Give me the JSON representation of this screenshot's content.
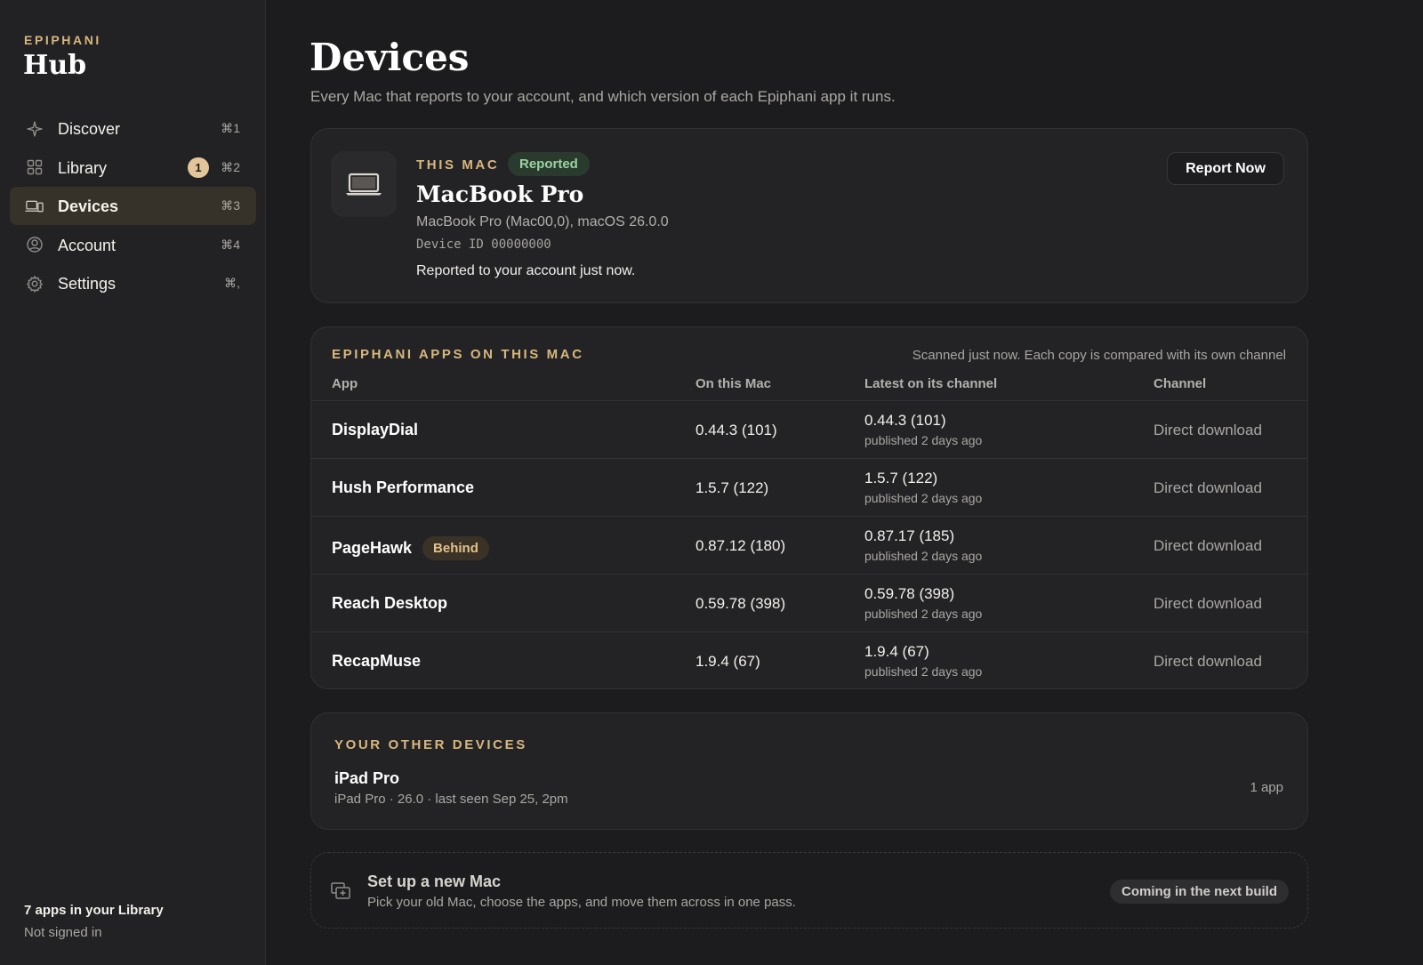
{
  "sidebar": {
    "brand_kicker": "EPIPHANI",
    "brand_title": "Hub",
    "items": [
      {
        "label": "Discover",
        "shortcut": "⌘1",
        "icon": "sparkle-icon",
        "active": false
      },
      {
        "label": "Library",
        "shortcut": "⌘2",
        "icon": "grid-icon",
        "badge": "1",
        "active": false
      },
      {
        "label": "Devices",
        "shortcut": "⌘3",
        "icon": "devices-icon",
        "active": true
      },
      {
        "label": "Account",
        "shortcut": "⌘4",
        "icon": "person-circle-icon",
        "active": false
      },
      {
        "label": "Settings",
        "shortcut": "⌘,",
        "icon": "gear-icon",
        "active": false
      }
    ],
    "footer": {
      "library_count": "7 apps in your Library",
      "auth_status": "Not signed in"
    }
  },
  "main": {
    "title": "Devices",
    "subtitle": "Every Mac that reports to your account, and which version of each Epiphani app it runs."
  },
  "this_mac": {
    "kicker": "THIS MAC",
    "status": "Reported",
    "name": "MacBook Pro",
    "model": "MacBook Pro (Mac00,0), macOS 26.0.0",
    "device_id": "Device ID 00000000",
    "reported_text": "Reported to your account just now.",
    "report_button": "Report Now",
    "icon": "laptop-icon"
  },
  "apps": {
    "kicker": "EPIPHANI APPS ON THIS MAC",
    "note": "Scanned just now. Each copy is compared with its own channel",
    "headers": {
      "app": "App",
      "on_mac": "On this Mac",
      "latest": "Latest on its channel",
      "channel": "Channel"
    },
    "rows": [
      {
        "name": "DisplayDial",
        "badge": "",
        "on_mac": "0.44.3 (101)",
        "latest": "0.44.3 (101)",
        "published": "published 2 days ago",
        "channel": "Direct download"
      },
      {
        "name": "Hush Performance",
        "badge": "",
        "on_mac": "1.5.7 (122)",
        "latest": "1.5.7 (122)",
        "published": "published 2 days ago",
        "channel": "Direct download"
      },
      {
        "name": "PageHawk",
        "badge": "Behind",
        "on_mac": "0.87.12 (180)",
        "latest": "0.87.17 (185)",
        "published": "published 2 days ago",
        "channel": "Direct download"
      },
      {
        "name": "Reach Desktop",
        "badge": "",
        "on_mac": "0.59.78 (398)",
        "latest": "0.59.78 (398)",
        "published": "published 2 days ago",
        "channel": "Direct download"
      },
      {
        "name": "RecapMuse",
        "badge": "",
        "on_mac": "1.9.4 (67)",
        "latest": "1.9.4 (67)",
        "published": "published 2 days ago",
        "channel": "Direct download"
      }
    ]
  },
  "other_devices": {
    "kicker": "YOUR OTHER DEVICES",
    "items": [
      {
        "name": "iPad Pro",
        "meta": "iPad Pro · 26.0 · last seen Sep 25, 2pm",
        "count": "1 app"
      }
    ]
  },
  "setup": {
    "title": "Set up a new Mac",
    "description": "Pick your old Mac, choose the apps, and move them across in one pass.",
    "badge": "Coming in the next build",
    "icon": "migrate-icon"
  },
  "colors": {
    "background": "#1c1c1e",
    "sidebar": "#222224",
    "accent_gold": "#d8b77c",
    "reported_green": "#9ad3a0",
    "active_nav": "#363129"
  }
}
